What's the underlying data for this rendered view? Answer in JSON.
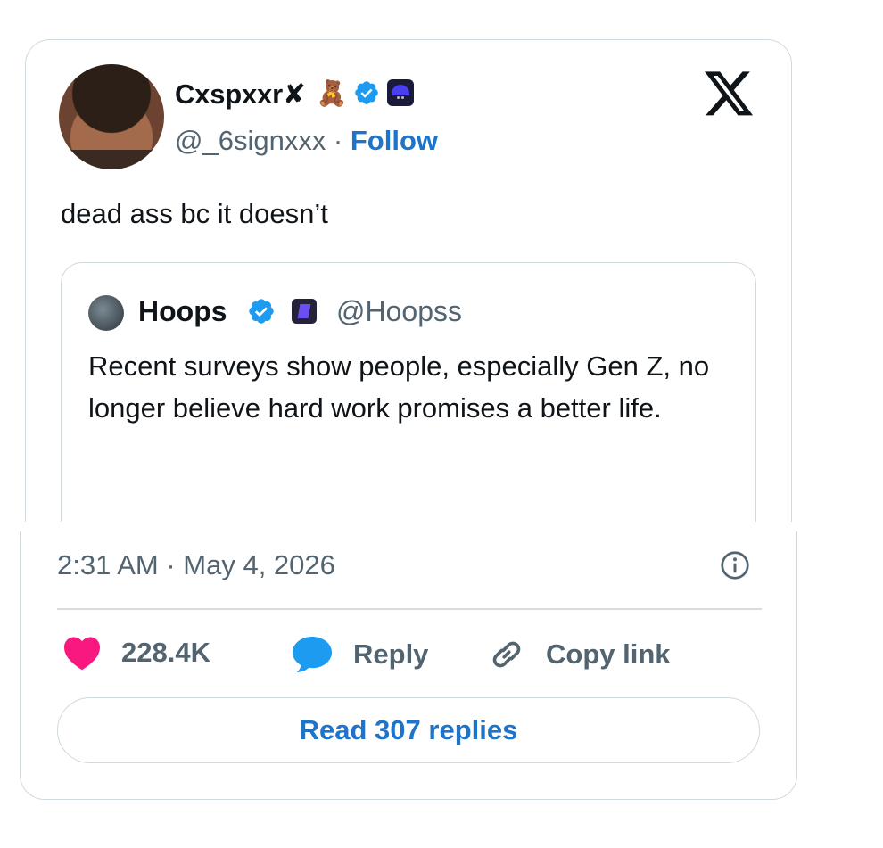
{
  "tweet": {
    "author": {
      "display_name": "Cxspxxr✘",
      "handle_line": "@_6signxxx · ",
      "follow_label": "Follow",
      "badges": [
        "teddy-bear-emoji",
        "verified-badge",
        "affiliate-badge"
      ]
    },
    "text": "dead ass bc it doesn’t",
    "platform_icon": "x-logo-icon"
  },
  "quoted_tweet": {
    "author": {
      "display_name": "Hoops",
      "handle": "@Hoopss",
      "badges": [
        "verified-badge",
        "affiliate-badge"
      ]
    },
    "text": "Recent surveys show people, especially Gen Z, no longer believe hard work promises a better life."
  },
  "footer": {
    "timestamp": "2:31 AM · May 4, 2026",
    "actions": {
      "likes": "228.4K",
      "reply_label": "Reply",
      "copy_label": "Copy link"
    },
    "read_replies_label": "Read 307 replies"
  },
  "colors": {
    "link_blue": "#1d74c8",
    "verified_blue": "#1d9bf0",
    "like_pink": "#f91880",
    "muted_text": "#536471"
  }
}
